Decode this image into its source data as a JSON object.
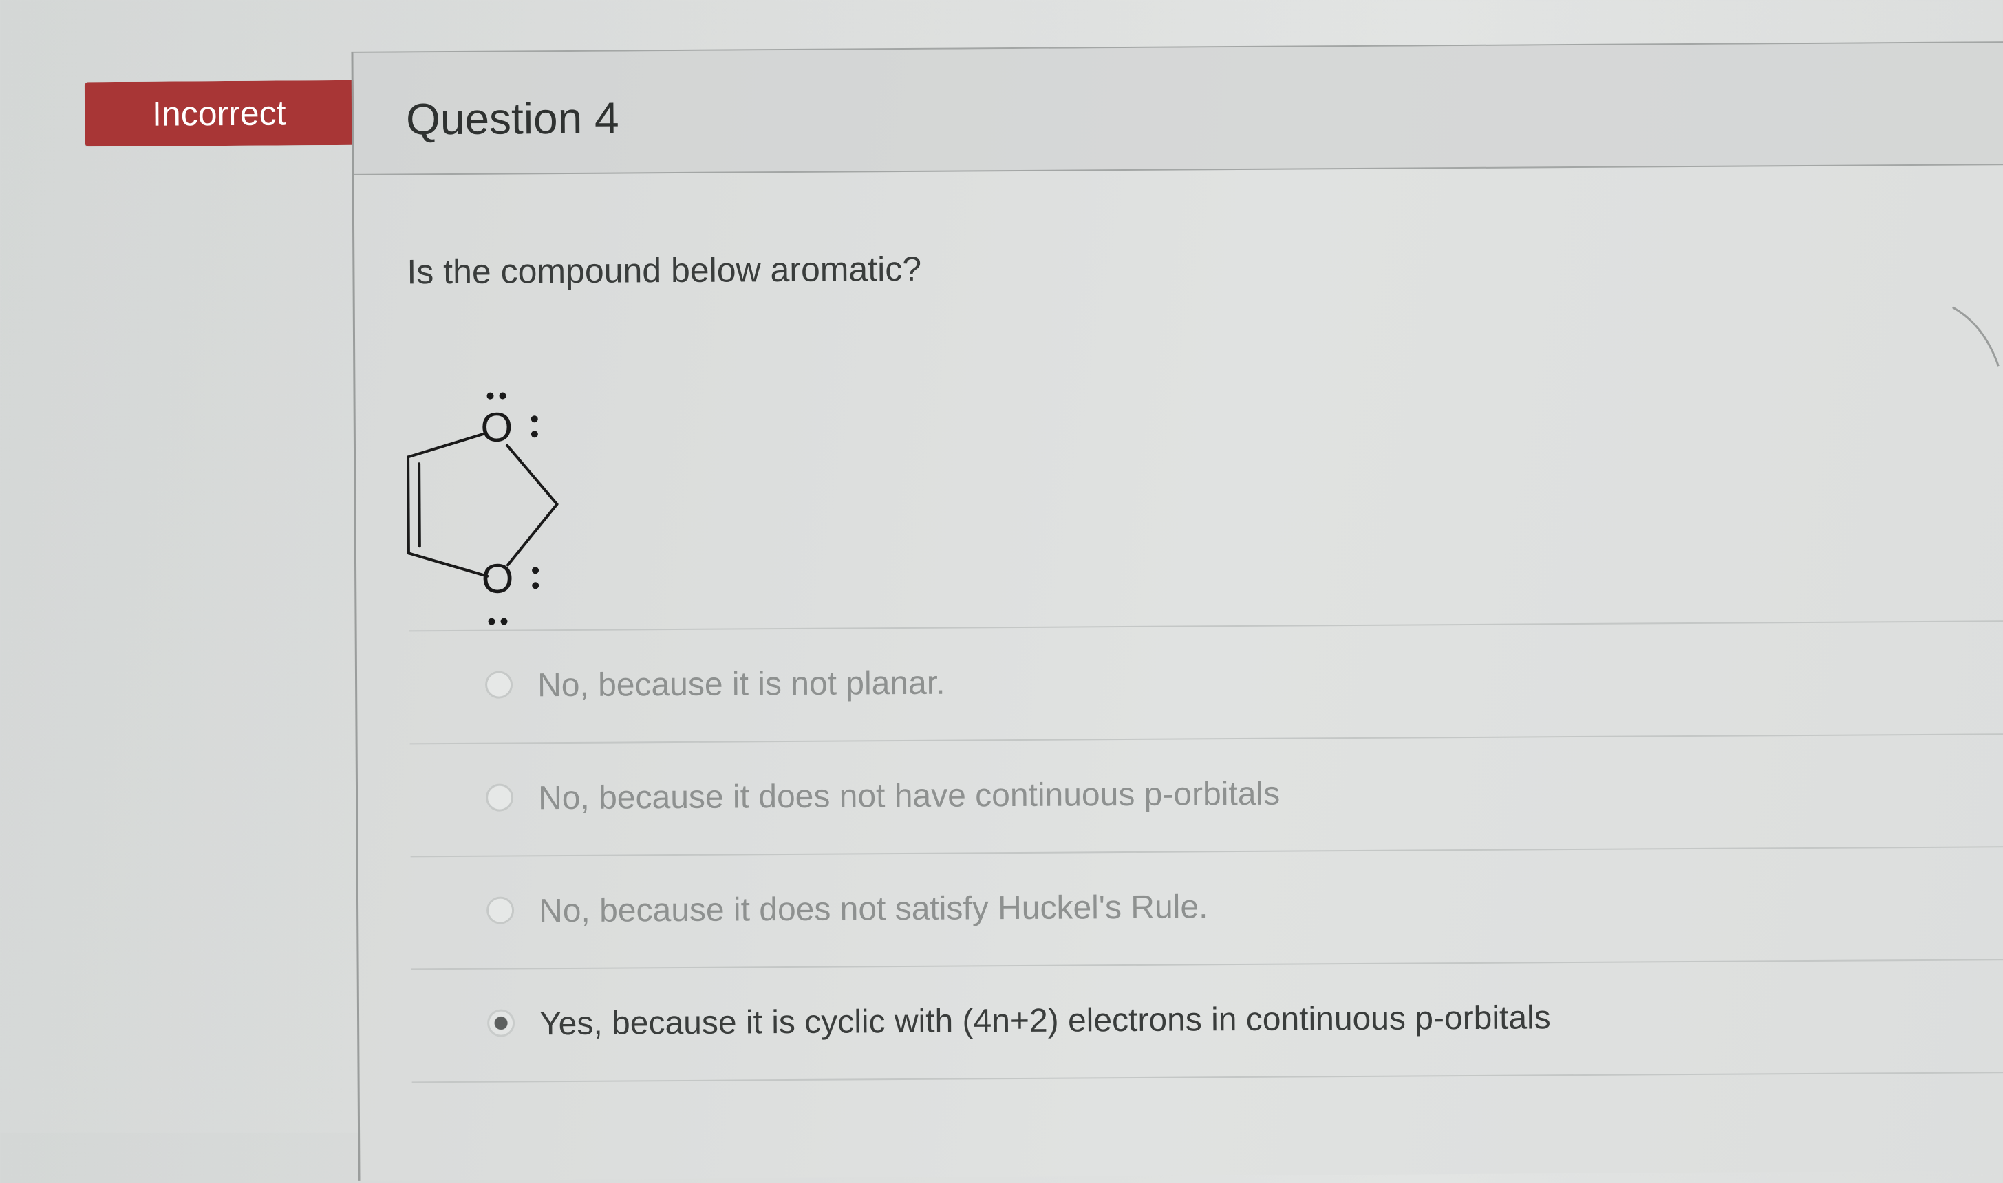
{
  "status": {
    "label": "Incorrect",
    "color": "#a83636"
  },
  "question": {
    "title": "Question 4",
    "prompt": "Is the compound below aromatic?",
    "structure": {
      "atom_label": "O",
      "description_icon": "1,3-dioxole-structure-icon"
    }
  },
  "answers": [
    {
      "label": "No, because it is not planar.",
      "selected": false
    },
    {
      "label": "No, because it does not have continuous p-orbitals",
      "selected": false
    },
    {
      "label": "No, because it does not satisfy Huckel's Rule.",
      "selected": false
    },
    {
      "label": "Yes, because it is cyclic with (4n+2) electrons in continuous p-orbitals",
      "selected": true
    }
  ]
}
